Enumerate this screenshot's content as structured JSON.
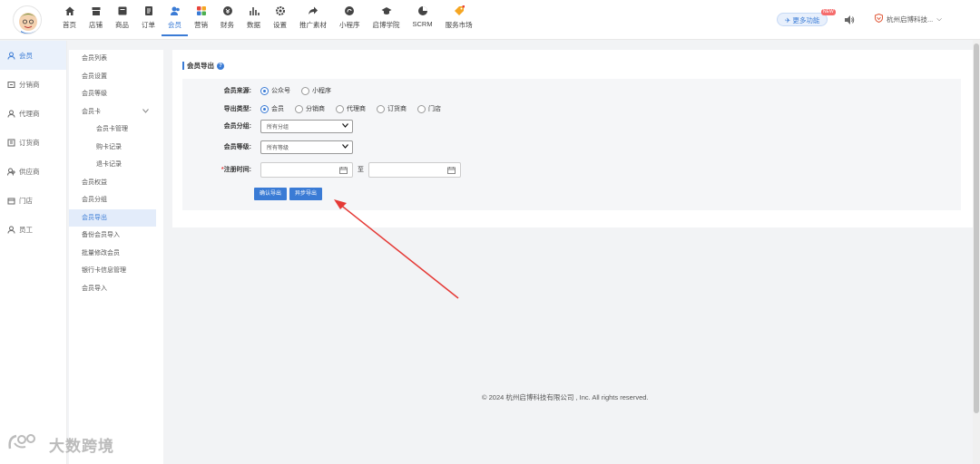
{
  "nav": [
    {
      "label": "首页",
      "icon": "home-icon"
    },
    {
      "label": "店铺",
      "icon": "store-icon"
    },
    {
      "label": "商品",
      "icon": "product-icon"
    },
    {
      "label": "订单",
      "icon": "order-icon"
    },
    {
      "label": "会员",
      "icon": "member-icon",
      "active": true
    },
    {
      "label": "营销",
      "icon": "marketing-icon"
    },
    {
      "label": "财务",
      "icon": "finance-icon"
    },
    {
      "label": "数据",
      "icon": "data-icon"
    },
    {
      "label": "设置",
      "icon": "settings-icon"
    },
    {
      "label": "推广素材",
      "icon": "promo-icon"
    },
    {
      "label": "小程序",
      "icon": "miniapp-icon"
    },
    {
      "label": "启博学院",
      "icon": "academy-icon"
    },
    {
      "label": "SCRM",
      "icon": "scrm-icon"
    },
    {
      "label": "服务市场",
      "icon": "market-icon"
    }
  ],
  "header": {
    "more_label": "更多功能",
    "new_badge": "NEW",
    "company": "杭州启博科技..."
  },
  "side1": [
    {
      "label": "会员",
      "active": true
    },
    {
      "label": "分销商"
    },
    {
      "label": "代理商"
    },
    {
      "label": "订货商"
    },
    {
      "label": "供应商"
    },
    {
      "label": "门店"
    },
    {
      "label": "员工"
    }
  ],
  "side2": [
    {
      "label": "会员列表"
    },
    {
      "label": "会员设置"
    },
    {
      "label": "会员等级"
    },
    {
      "label": "会员卡",
      "expand": true
    },
    {
      "label": "会员卡管理",
      "sub": true
    },
    {
      "label": "购卡记录",
      "sub": true
    },
    {
      "label": "退卡记录",
      "sub": true
    },
    {
      "label": "会员权益"
    },
    {
      "label": "会员分组"
    },
    {
      "label": "会员导出",
      "active": true
    },
    {
      "label": "备份会员导入"
    },
    {
      "label": "批量修改会员"
    },
    {
      "label": "银行卡信息管理"
    },
    {
      "label": "会员导入"
    }
  ],
  "panel": {
    "title": "会员导出",
    "help": "?",
    "source_label": "会员来源:",
    "source_options": [
      "公众号",
      "小程序"
    ],
    "type_label": "导出类型:",
    "type_options": [
      "会员",
      "分销商",
      "代理商",
      "订货商",
      "门店"
    ],
    "group_label": "会员分组:",
    "group_value": "所有分组",
    "level_label": "会员等级:",
    "level_value": "所有等级",
    "reg_label": "注册时间:",
    "reg_required": "*",
    "to_label": "至",
    "confirm_btn": "确认导出",
    "async_btn": "异步导出"
  },
  "footer": "© 2024 杭州启博科技有限公司 , Inc. All rights reserved.",
  "watermark": "大数跨境",
  "colors": {
    "accent": "#3a7bd5",
    "arrow": "#e53935"
  }
}
